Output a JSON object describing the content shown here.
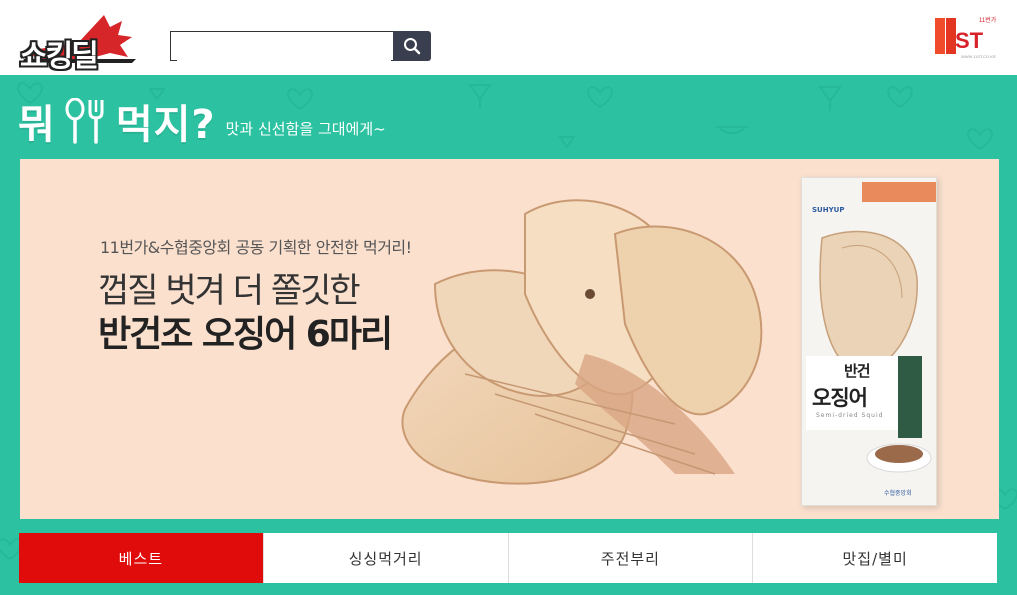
{
  "header": {
    "logo_text": "쇼킹딜",
    "search": {
      "value": "",
      "placeholder": ""
    },
    "brand_logo_text": "11ST",
    "brand_tag": "11번가",
    "brand_url": "WWW.11ST.CO.KR"
  },
  "banner": {
    "heading_left": "뭐",
    "heading_right": "먹지?",
    "subheading": "맛과 신선함을 그대에게~"
  },
  "promo": {
    "small_text": "11번가&수협중앙회 공동 기획한 안전한 먹거리!",
    "line1": "껍질 벗겨 더 쫄깃한",
    "line2": "반건조 오징어 6마리",
    "package": {
      "badge": "SUHYUP",
      "title_1": "반건",
      "title_2": "오징어",
      "title_en": "Semi-dried Squid",
      "maker": "수협중앙회"
    }
  },
  "tabs": [
    {
      "label": "베스트",
      "active": true
    },
    {
      "label": "싱싱먹거리",
      "active": false
    },
    {
      "label": "주전부리",
      "active": false
    },
    {
      "label": "맛집/별미",
      "active": false
    }
  ],
  "colors": {
    "mint": "#2cc2a1",
    "active_tab": "#e00b0b",
    "promo_bg": "#fbe0ce"
  }
}
